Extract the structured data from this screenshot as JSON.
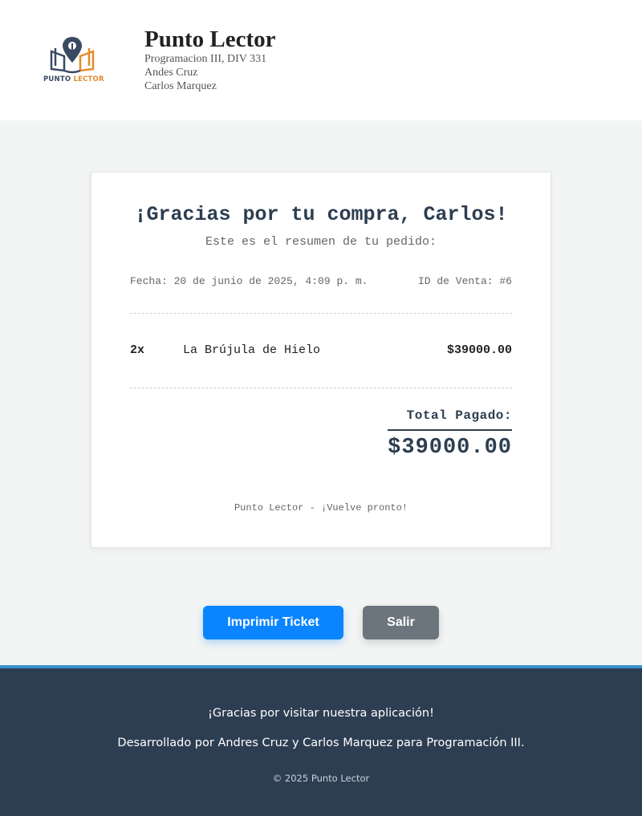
{
  "header": {
    "logo": {
      "icon": "book-location-pin-logo",
      "word1": "PUNTO",
      "word2": "LECTOR"
    },
    "title": "Punto Lector",
    "lines": [
      "Programacion III, DIV 331",
      "Andes Cruz",
      "Carlos Marquez"
    ]
  },
  "receipt": {
    "title": "¡Gracias por tu compra, Carlos!",
    "subtitle": "Este es el resumen de tu pedido:",
    "date": "Fecha: 20 de junio de 2025, 4:09 p. m.",
    "sale_id": "ID de Venta: #6",
    "items": [
      {
        "qty": "2x",
        "name": "La Brújula de Hielo",
        "price": "$39000.00"
      }
    ],
    "total_label": "Total Pagado:",
    "total_value": "$39000.00",
    "footer": "Punto Lector - ¡Vuelve pronto!"
  },
  "buttons": {
    "print": "Imprimir Ticket",
    "exit": "Salir"
  },
  "footer": {
    "line1": "¡Gracias por visitar nuestra aplicación!",
    "line2": "Desarrollado por Andres Cruz y Carlos Marquez para Programación III.",
    "copyright": "© 2025 Punto Lector"
  },
  "colors": {
    "accent": "#0a84ff",
    "secondary_button": "#6c757d",
    "footer_bg": "#2e3e52",
    "footer_border": "#3a8fd0",
    "heading": "#2c3e50",
    "logo_orange": "#e58a2b",
    "logo_navy": "#3a4a63"
  }
}
